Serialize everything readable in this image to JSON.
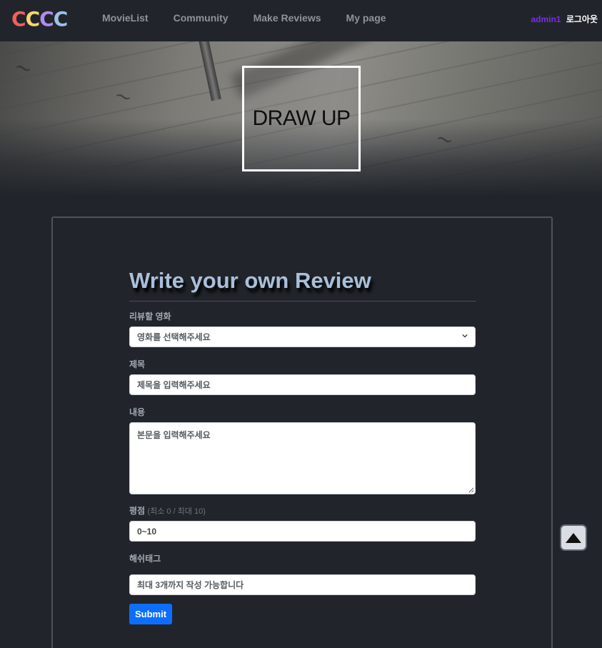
{
  "brand": {
    "letters": [
      "C",
      "C",
      "C",
      "C"
    ],
    "colors": [
      "#f25f5c",
      "#f5d76e",
      "#b18cf0",
      "#9fc1e6"
    ]
  },
  "nav": {
    "links": [
      "MovieList",
      "Community",
      "Make Reviews",
      "My page"
    ],
    "username": "admin1",
    "logout": "로그아웃"
  },
  "hero": {
    "title": "DRAW UP"
  },
  "form": {
    "title": "Write your own Review",
    "movie": {
      "label": "리뷰할 영화",
      "selected": "영화를 선택해주세요"
    },
    "subject": {
      "label": "제목",
      "placeholder": "제목을 입력해주세요"
    },
    "content": {
      "label": "내용",
      "placeholder": "본문을 입력해주세요"
    },
    "rating": {
      "label": "평점",
      "hint": "(최소 0 / 최대 10)",
      "placeholder": "0~10"
    },
    "hashtag": {
      "label": "해쉬태그",
      "placeholder": "최대 3개까지 작성 가능합니다"
    },
    "submit": "Submit"
  },
  "icons": {
    "scroll_top": "triangle-up-icon",
    "select": "chevron-down-icon"
  },
  "colors": {
    "accent": "#0d6efd",
    "background": "#21252b",
    "user": "#7a2fe0"
  }
}
